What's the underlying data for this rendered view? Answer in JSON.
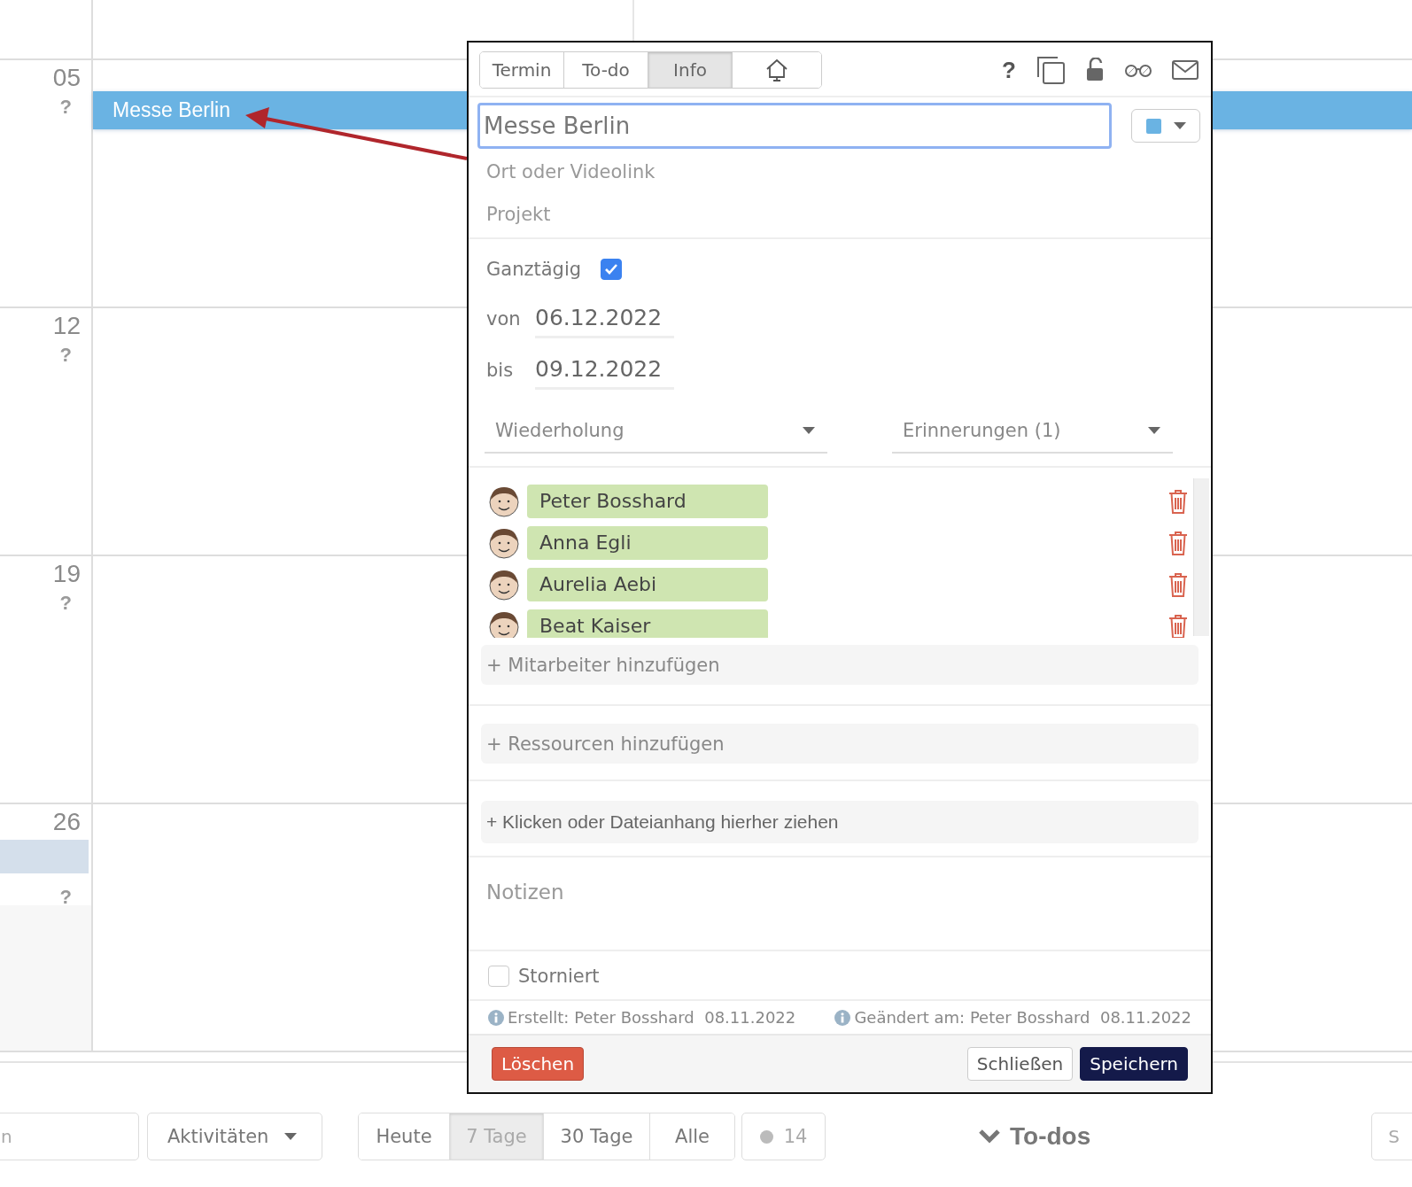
{
  "calendar": {
    "weeks": [
      {
        "number": "05",
        "status": "?",
        "current": false
      },
      {
        "number": "12",
        "status": "?",
        "current": false
      },
      {
        "number": "19",
        "status": "?",
        "current": false
      },
      {
        "number": "26",
        "status": "?",
        "current": true
      }
    ],
    "events": [
      {
        "title": "Messe Berlin",
        "color": "#6ab3e3"
      }
    ]
  },
  "dialog": {
    "tabs": [
      {
        "label": "Termin",
        "selected": false
      },
      {
        "label": "To-do",
        "selected": false
      },
      {
        "label": "Info",
        "selected": true
      }
    ],
    "home_tab": {
      "selected": false
    },
    "help": "?",
    "title": "Messe Berlin",
    "color": "#6ab3e3",
    "location": {
      "placeholder": "Ort oder Videolink"
    },
    "project": {
      "placeholder": "Projekt"
    },
    "all_day": {
      "label": "Ganztägig",
      "checked": true
    },
    "from": {
      "label": "von",
      "value": "06.12.2022"
    },
    "to": {
      "label": "bis",
      "value": "09.12.2022"
    },
    "repeat": "Wiederholung",
    "reminders": "Erinnerungen (1)",
    "participants": [
      {
        "name": "Peter Bosshard"
      },
      {
        "name": "Anna Egli"
      },
      {
        "name": "Aurelia Aebi"
      },
      {
        "name": "Beat Kaiser"
      }
    ],
    "add_staff": "+ Mitarbeiter hinzufügen",
    "add_resources": "+ Ressourcen hinzufügen",
    "attachments": "+ Klicken oder Dateianhang hierher ziehen",
    "notes": {
      "placeholder": "Notizen"
    },
    "cancelled": {
      "label": "Storniert",
      "checked": false
    },
    "created": "Erstellt: Peter Bosshard  08.11.2022",
    "changed": "Geändert am: Peter Bosshard  08.11.2022",
    "buttons": {
      "delete": "Löschen",
      "close": "Schließen",
      "save": "Speichern"
    }
  },
  "toolbar": {
    "search": {
      "placeholder": "n"
    },
    "activities": "Aktivitäten",
    "ranges": [
      {
        "label": "Heute",
        "selected": false
      },
      {
        "label": "7 Tage",
        "selected": true
      },
      {
        "label": "30 Tage",
        "selected": false
      },
      {
        "label": "Alle",
        "selected": false
      }
    ],
    "count": "14",
    "todos": "To-dos",
    "field": {
      "placeholder": "S"
    }
  }
}
